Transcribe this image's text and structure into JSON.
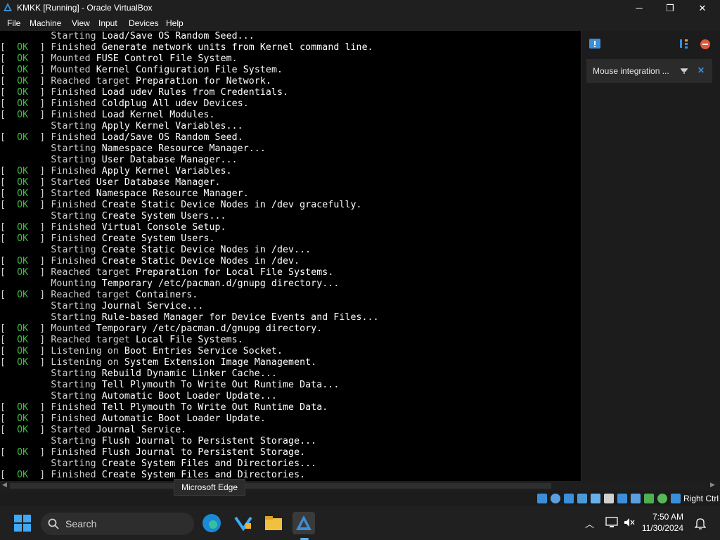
{
  "window": {
    "title": "KMKK [Running] - Oracle VirtualBox",
    "minimize": "─",
    "maximize": "❐",
    "close": "✕"
  },
  "menu": [
    "File",
    "Machine",
    "View",
    "Input",
    "Devices",
    "Help"
  ],
  "console_lines": [
    {
      "ok": false,
      "verb": "Starting",
      "text": "Load/Save OS Random Seed..."
    },
    {
      "ok": true,
      "verb": "Finished",
      "text": "Generate network units from Kernel command line."
    },
    {
      "ok": true,
      "verb": "Mounted",
      "text": "FUSE Control File System."
    },
    {
      "ok": true,
      "verb": "Mounted",
      "text": "Kernel Configuration File System."
    },
    {
      "ok": true,
      "verb": "Reached target",
      "text": "Preparation for Network."
    },
    {
      "ok": true,
      "verb": "Finished",
      "text": "Load udev Rules from Credentials."
    },
    {
      "ok": true,
      "verb": "Finished",
      "text": "Coldplug All udev Devices."
    },
    {
      "ok": true,
      "verb": "Finished",
      "text": "Load Kernel Modules."
    },
    {
      "ok": false,
      "verb": "Starting",
      "text": "Apply Kernel Variables..."
    },
    {
      "ok": true,
      "verb": "Finished",
      "text": "Load/Save OS Random Seed."
    },
    {
      "ok": false,
      "verb": "Starting",
      "text": "Namespace Resource Manager..."
    },
    {
      "ok": false,
      "verb": "Starting",
      "text": "User Database Manager..."
    },
    {
      "ok": true,
      "verb": "Finished",
      "text": "Apply Kernel Variables."
    },
    {
      "ok": true,
      "verb": "Started",
      "text": "User Database Manager."
    },
    {
      "ok": true,
      "verb": "Started",
      "text": "Namespace Resource Manager."
    },
    {
      "ok": true,
      "verb": "Finished",
      "text": "Create Static Device Nodes in /dev gracefully."
    },
    {
      "ok": false,
      "verb": "Starting",
      "text": "Create System Users..."
    },
    {
      "ok": true,
      "verb": "Finished",
      "text": "Virtual Console Setup."
    },
    {
      "ok": true,
      "verb": "Finished",
      "text": "Create System Users."
    },
    {
      "ok": false,
      "verb": "Starting",
      "text": "Create Static Device Nodes in /dev..."
    },
    {
      "ok": true,
      "verb": "Finished",
      "text": "Create Static Device Nodes in /dev."
    },
    {
      "ok": true,
      "verb": "Reached target",
      "text": "Preparation for Local File Systems."
    },
    {
      "ok": false,
      "verb": "Mounting",
      "text": "Temporary /etc/pacman.d/gnupg directory..."
    },
    {
      "ok": true,
      "verb": "Reached target",
      "text": "Containers."
    },
    {
      "ok": false,
      "verb": "Starting",
      "text": "Journal Service..."
    },
    {
      "ok": false,
      "verb": "Starting",
      "text": "Rule-based Manager for Device Events and Files..."
    },
    {
      "ok": true,
      "verb": "Mounted",
      "text": "Temporary /etc/pacman.d/gnupg directory."
    },
    {
      "ok": true,
      "verb": "Reached target",
      "text": "Local File Systems."
    },
    {
      "ok": true,
      "verb": "Listening on",
      "text": "Boot Entries Service Socket."
    },
    {
      "ok": true,
      "verb": "Listening on",
      "text": "System Extension Image Management."
    },
    {
      "ok": false,
      "verb": "Starting",
      "text": "Rebuild Dynamic Linker Cache..."
    },
    {
      "ok": false,
      "verb": "Starting",
      "text": "Tell Plymouth To Write Out Runtime Data..."
    },
    {
      "ok": false,
      "verb": "Starting",
      "text": "Automatic Boot Loader Update..."
    },
    {
      "ok": true,
      "verb": "Finished",
      "text": "Tell Plymouth To Write Out Runtime Data."
    },
    {
      "ok": true,
      "verb": "Finished",
      "text": "Automatic Boot Loader Update."
    },
    {
      "ok": true,
      "verb": "Started",
      "text": "Journal Service."
    },
    {
      "ok": false,
      "verb": "Starting",
      "text": "Flush Journal to Persistent Storage..."
    },
    {
      "ok": true,
      "verb": "Finished",
      "text": "Flush Journal to Persistent Storage."
    },
    {
      "ok": false,
      "verb": "Starting",
      "text": "Create System Files and Directories..."
    },
    {
      "ok": true,
      "verb": "Finished",
      "text": "Create System Files and Directories."
    }
  ],
  "ok_label": "OK",
  "side_panel": {
    "notification_text": "Mouse integration ...",
    "close": "✕"
  },
  "tooltip": "Microsoft Edge",
  "statusbar": {
    "host_key": "Right Ctrl"
  },
  "taskbar": {
    "search_placeholder": "Search",
    "time": "7:50 AM",
    "date": "11/30/2024"
  },
  "colors": {
    "ok_green": "#3fbf3f",
    "console_bg": "#000000",
    "accent": "#0078d4"
  }
}
